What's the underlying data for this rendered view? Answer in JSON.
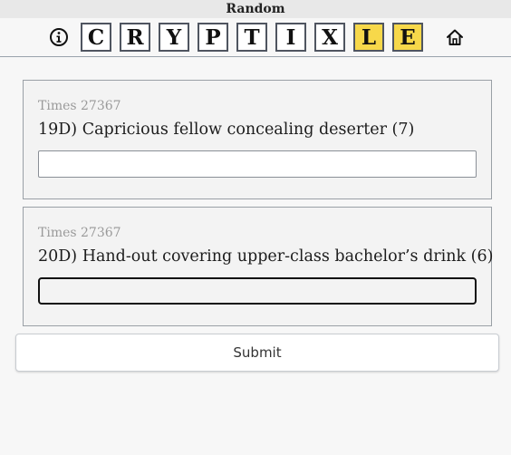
{
  "top_bar": {
    "title": "Random"
  },
  "header": {
    "info_icon": "info-circle-icon",
    "home_icon": "home-icon",
    "tiles": [
      {
        "letter": "C",
        "highlighted": false
      },
      {
        "letter": "R",
        "highlighted": false
      },
      {
        "letter": "Y",
        "highlighted": false
      },
      {
        "letter": "P",
        "highlighted": false
      },
      {
        "letter": "T",
        "highlighted": false
      },
      {
        "letter": "I",
        "highlighted": false
      },
      {
        "letter": "X",
        "highlighted": false
      },
      {
        "letter": "L",
        "highlighted": true
      },
      {
        "letter": "E",
        "highlighted": true
      }
    ],
    "highlight_color": "#f7d84a"
  },
  "clues": [
    {
      "source": "Times 27367",
      "text": "19D) Capricious fellow concealing deserter (7)",
      "answer_value": "",
      "focused": false
    },
    {
      "source": "Times 27367",
      "text": "20D) Hand-out covering upper-class bachelor’s drink (6)",
      "answer_value": "",
      "focused": true
    }
  ],
  "submit": {
    "label": "Submit"
  }
}
